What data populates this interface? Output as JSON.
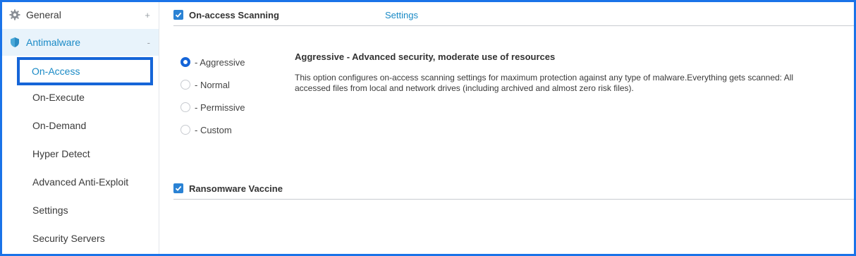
{
  "sidebar": {
    "general": {
      "label": "General",
      "toggle": "+",
      "icon": "gear-icon"
    },
    "antimalware": {
      "label": "Antimalware",
      "toggle": "-",
      "icon": "shield-icon"
    },
    "items": [
      {
        "label": "On-Access",
        "active": true
      },
      {
        "label": "On-Execute"
      },
      {
        "label": "On-Demand"
      },
      {
        "label": "Hyper Detect"
      },
      {
        "label": "Advanced Anti-Exploit"
      },
      {
        "label": "Settings"
      },
      {
        "label": "Security Servers"
      }
    ]
  },
  "main": {
    "on_access": {
      "title": "On-access Scanning",
      "checked": true,
      "settings_link": "Settings"
    },
    "radio_options": [
      {
        "label": "- Aggressive",
        "selected": true
      },
      {
        "label": "- Normal",
        "selected": false
      },
      {
        "label": "- Permissive",
        "selected": false
      },
      {
        "label": "- Custom",
        "selected": false
      }
    ],
    "description": {
      "title": "Aggressive - Advanced security, moderate use of resources",
      "body": "This option configures on-access scanning settings for maximum protection against any type of malware.Everything gets scanned: All accessed files from local and network drives (including archived and almost zero risk files)."
    },
    "ransomware": {
      "title": "Ransomware Vaccine",
      "checked": true
    }
  },
  "colors": {
    "accent": "#1a8ac6",
    "highlight_border": "#1565d8",
    "checkbox": "#2a82d4",
    "active_bg": "#e8f3fb"
  }
}
